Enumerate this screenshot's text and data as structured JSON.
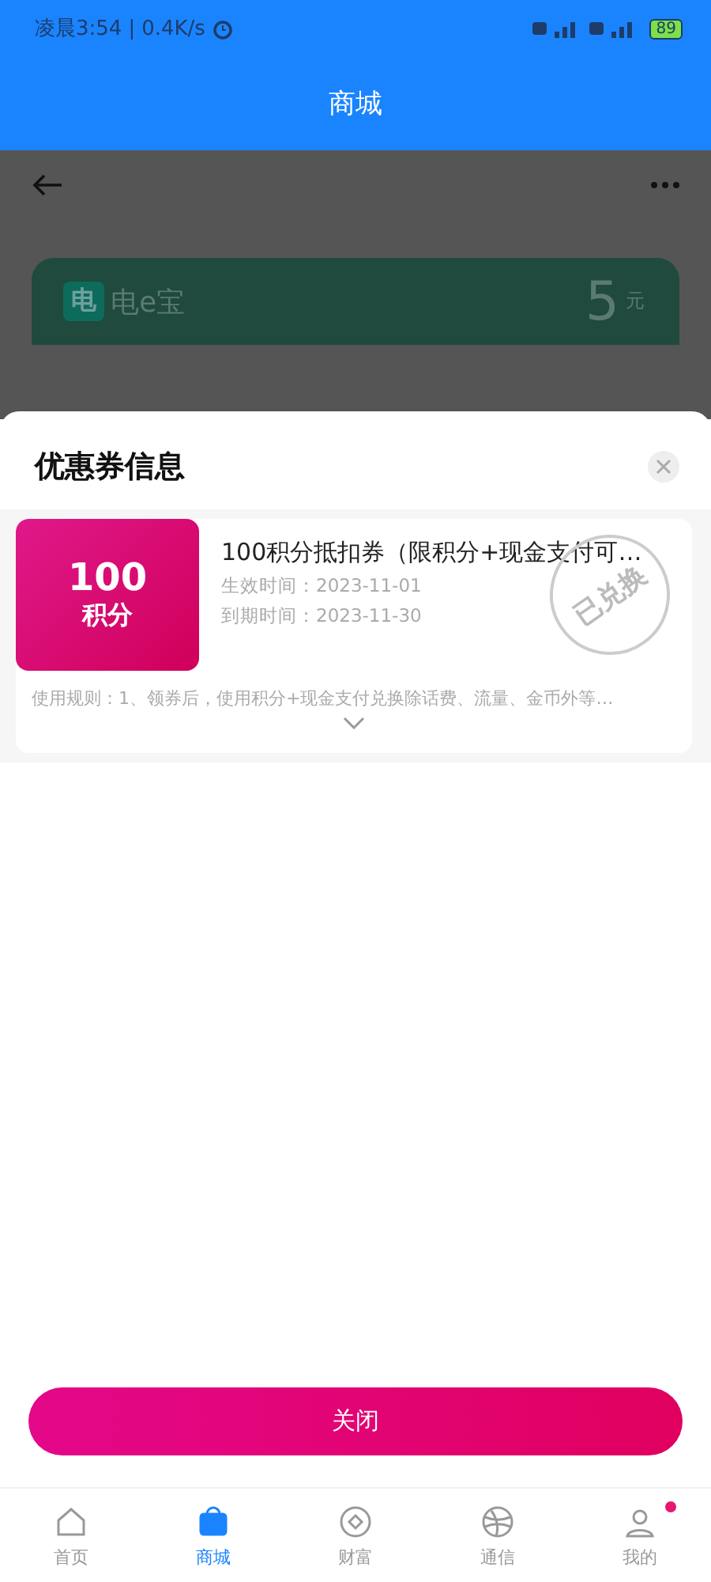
{
  "status_bar": {
    "time": "凌晨3:54",
    "separator": "|",
    "speed": "0.4K/s",
    "battery": "89"
  },
  "header": {
    "title": "商城"
  },
  "background_banner": {
    "logo": "电",
    "brand": "电e宝",
    "amount": "5",
    "unit": "元"
  },
  "sheet": {
    "title": "优惠券信息",
    "coupon": {
      "value": "100",
      "unit": "积分",
      "name": "100积分抵扣券（限积分+现金支付可…",
      "start": "生效时间：2023-11-01",
      "end": "到期时间：2023-11-30",
      "rules": "使用规则：1、领券后，使用积分+现金支付兑换除话费、流量、金币外等…",
      "stamp": "已兑换",
      "redeemed": true
    },
    "close_button": "关闭"
  },
  "nav": [
    {
      "label": "首页",
      "selected": false,
      "badge": false
    },
    {
      "label": "商城",
      "selected": true,
      "badge": false
    },
    {
      "label": "财富",
      "selected": false,
      "badge": false
    },
    {
      "label": "通信",
      "selected": false,
      "badge": false
    },
    {
      "label": "我的",
      "selected": false,
      "badge": true
    }
  ]
}
